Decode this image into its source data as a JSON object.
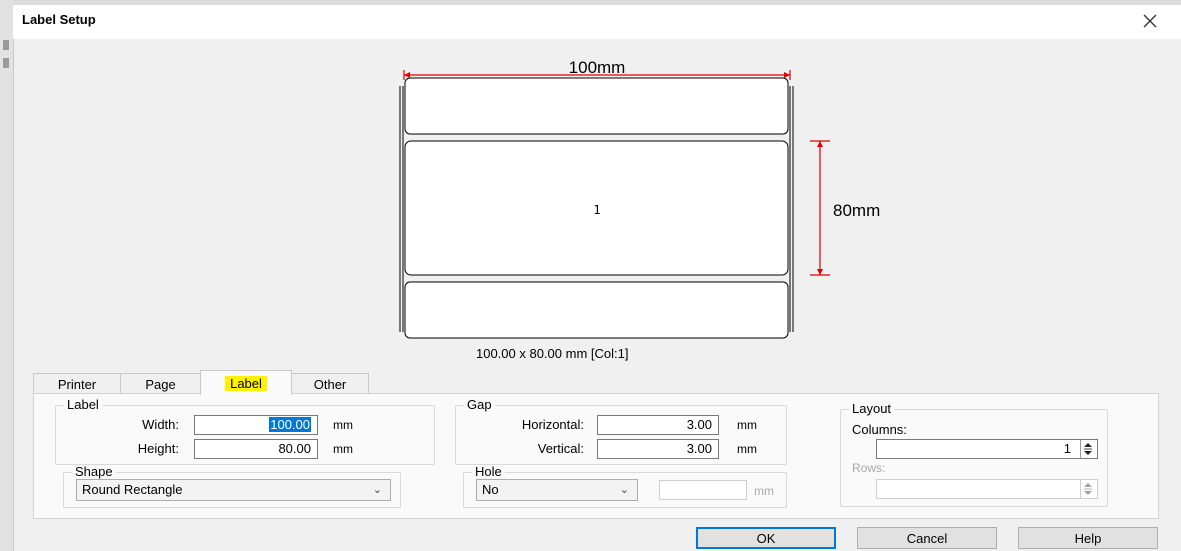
{
  "dialog": {
    "title": "Label Setup"
  },
  "preview": {
    "width_label": "100mm",
    "height_label": "80mm",
    "label_number": "1",
    "summary": "100.00 x 80.00 mm [Col:1]"
  },
  "tabs": [
    {
      "label": "Printer",
      "active": false
    },
    {
      "label": "Page",
      "active": false
    },
    {
      "label": "Label",
      "active": true
    },
    {
      "label": "Other",
      "active": false
    }
  ],
  "label_group": {
    "title": "Label",
    "width_label": "Width:",
    "width_value": "100.00",
    "height_label": "Height:",
    "height_value": "80.00",
    "unit": "mm"
  },
  "gap_group": {
    "title": "Gap",
    "horizontal_label": "Horizontal:",
    "horizontal_value": "3.00",
    "vertical_label": "Vertical:",
    "vertical_value": "3.00",
    "unit": "mm"
  },
  "layout_group": {
    "title": "Layout",
    "columns_label": "Columns:",
    "columns_value": "1",
    "rows_label": "Rows:",
    "rows_value": ""
  },
  "shape_group": {
    "title": "Shape",
    "selected": "Round Rectangle"
  },
  "hole_group": {
    "title": "Hole",
    "selected": "No",
    "value": "",
    "unit": "mm"
  },
  "buttons": {
    "ok": "OK",
    "cancel": "Cancel",
    "help": "Help"
  },
  "colors": {
    "dimension": "#e00000",
    "highlight": "#fff200",
    "focus": "#0078d7"
  },
  "icons": {
    "close": "close-icon",
    "dropdown": "chevron-down-icon",
    "spinner": "spin-arrows-icon"
  }
}
